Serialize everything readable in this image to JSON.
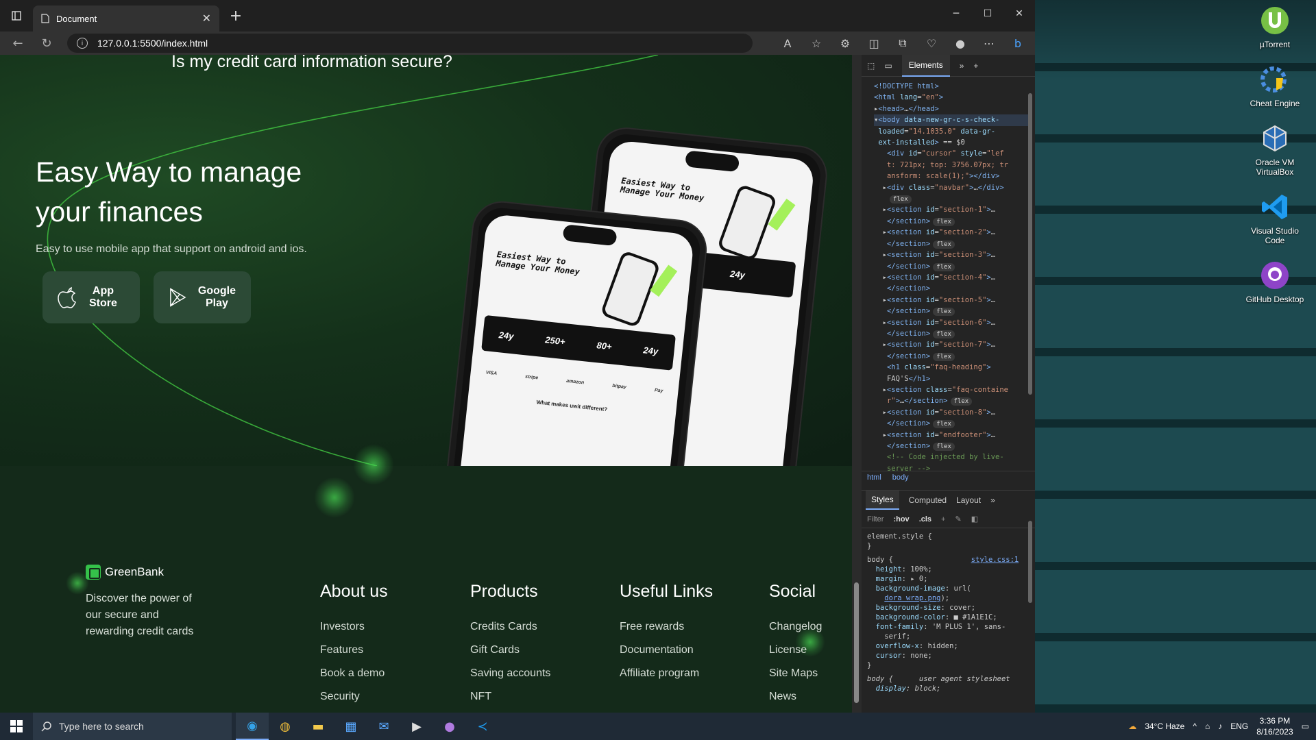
{
  "browser": {
    "tab_title": "Document",
    "url": "127.0.0.1:5500/index.html",
    "new_tab": "+",
    "tab_close": "✕"
  },
  "page": {
    "faq_question": "Is my credit card information secure?",
    "hero_title": "Easy Way to manage your finances",
    "hero_subtitle": "Easy to use mobile app that support on android and ios.",
    "app_store_label": "App\nStore",
    "google_play_label": "Google\nPlay",
    "phone_back": {
      "title": "Easiest Way to\nManage Your Money",
      "stat": "24y"
    },
    "phone_front": {
      "title": "Easiest Way to\nManage Your Money",
      "stats": [
        "24y",
        "250+",
        "80+",
        "24y"
      ],
      "logos": [
        "VISA",
        "stripe",
        "amazon",
        "bitpay",
        "Pay"
      ],
      "diff_heading": "What makes uwit different?"
    }
  },
  "footer": {
    "brand": "GreenBank",
    "brand_desc": "Discover the power of our secure and rewarding credit cards",
    "columns": [
      {
        "title": "About us",
        "links": [
          "Investors",
          "Features",
          "Book a demo",
          "Security"
        ]
      },
      {
        "title": "Products",
        "links": [
          "Credits Cards",
          "Gift Cards",
          "Saving accounts",
          "NFT"
        ]
      },
      {
        "title": "Useful Links",
        "links": [
          "Free rewards",
          "Documentation",
          "Affiliate program"
        ]
      },
      {
        "title": "Social",
        "links": [
          "Changelog",
          "License",
          "Site Maps",
          "News"
        ]
      }
    ]
  },
  "devtools": {
    "main_tab": "Elements",
    "breadcrumb": [
      "html",
      "body"
    ],
    "subtabs": [
      "Styles",
      "Computed",
      "Layout"
    ],
    "filter_placeholder": "Filter",
    "hov": ":hov",
    "cls": ".cls",
    "badge_flex": "flex",
    "stylesheet_link": "style.css:1",
    "ua_label": "user agent stylesheet"
  },
  "desktop_icons": [
    "µTorrent",
    "Cheat Engine",
    "Oracle VM VirtualBox",
    "Visual Studio Code",
    "GitHub Desktop"
  ],
  "taskbar": {
    "search_placeholder": "Type here to search",
    "weather": "34°C  Haze",
    "lang": "ENG",
    "time": "3:36 PM",
    "date": "8/16/2023"
  },
  "colors": {
    "accent_green": "#35c24a",
    "lime": "#a4f05a",
    "page_bg": "#142a1a"
  }
}
